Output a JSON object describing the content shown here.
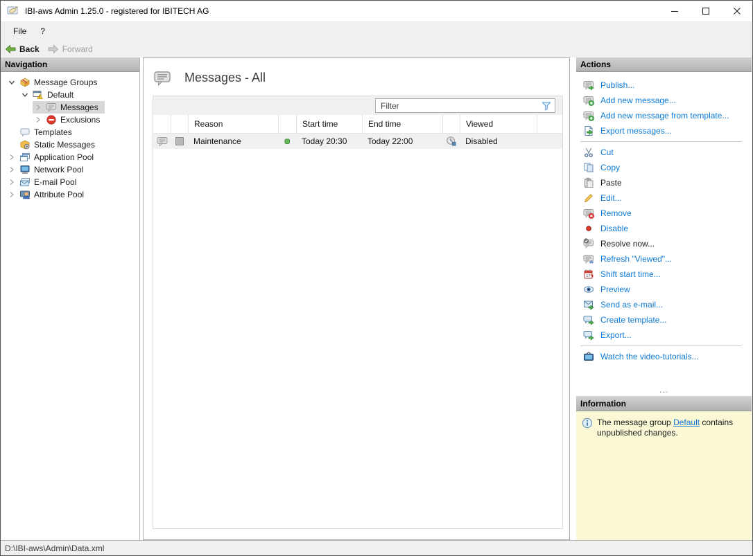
{
  "window": {
    "title": "IBI-aws Admin 1.25.0 - registered for IBITECH AG",
    "controls": [
      "minimize",
      "maximize",
      "close"
    ]
  },
  "menu": {
    "items": [
      "File",
      "?"
    ]
  },
  "toolbar": {
    "back": "Back",
    "forward": "Forward",
    "back_icon": "back-arrow",
    "forward_icon": "forward-arrow"
  },
  "navigation": {
    "header": "Navigation",
    "tree": [
      {
        "label": "Message Groups",
        "level": 0,
        "chevron": "down",
        "icon": "message-groups",
        "selected": false
      },
      {
        "label": "Default",
        "level": 1,
        "chevron": "down",
        "icon": "default-group",
        "selected": false
      },
      {
        "label": "Messages",
        "level": 2,
        "chevron": "right",
        "icon": "messages",
        "selected": true
      },
      {
        "label": "Exclusions",
        "level": 2,
        "chevron": "right",
        "icon": "exclusions",
        "selected": false
      },
      {
        "label": "Templates",
        "level": 0,
        "chevron": "none",
        "icon": "templates",
        "selected": false
      },
      {
        "label": "Static Messages",
        "level": 0,
        "chevron": "none",
        "icon": "static-messages",
        "selected": false
      },
      {
        "label": "Application Pool",
        "level": 0,
        "chevron": "right",
        "icon": "application-pool",
        "selected": false
      },
      {
        "label": "Network Pool",
        "level": 0,
        "chevron": "right",
        "icon": "network-pool",
        "selected": false
      },
      {
        "label": "E-mail Pool",
        "level": 0,
        "chevron": "right",
        "icon": "email-pool",
        "selected": false
      },
      {
        "label": "Attribute Pool",
        "level": 0,
        "chevron": "right",
        "icon": "attribute-pool",
        "selected": false
      }
    ]
  },
  "main": {
    "title": "Messages - All",
    "title_icon": "messages-bubble",
    "filter": {
      "placeholder": "Filter",
      "icon": "filter-funnel"
    },
    "table": {
      "columns": [
        "Reason",
        "Start time",
        "End time",
        "Viewed"
      ],
      "rows": [
        {
          "type_icon": "message-bubble",
          "color_icon": "gray-square",
          "reason": "Maintenance",
          "status_icon": "green-dot",
          "start_time": "Today 20:30",
          "end_time": "Today 22:00",
          "viewed_icon": "viewed-clock",
          "viewed": "Disabled"
        }
      ]
    }
  },
  "actions": {
    "header": "Actions",
    "splitter": "...",
    "items": [
      {
        "label": "Publish...",
        "icon": "publish",
        "enabled": true
      },
      {
        "label": "Add new message...",
        "icon": "add-message",
        "enabled": true
      },
      {
        "label": "Add new message from template...",
        "icon": "add-message",
        "enabled": true
      },
      {
        "label": "Export messages...",
        "icon": "export-messages",
        "enabled": true
      },
      {
        "type": "separator"
      },
      {
        "label": "Cut",
        "icon": "cut",
        "enabled": true
      },
      {
        "label": "Copy",
        "icon": "copy",
        "enabled": true
      },
      {
        "label": "Paste",
        "icon": "paste",
        "enabled": false
      },
      {
        "label": "Edit...",
        "icon": "edit",
        "enabled": true
      },
      {
        "label": "Remove",
        "icon": "remove",
        "enabled": true
      },
      {
        "label": "Disable",
        "icon": "disable",
        "enabled": true
      },
      {
        "label": "Resolve now...",
        "icon": "resolve",
        "enabled": false
      },
      {
        "label": "Refresh \"Viewed\"...",
        "icon": "refresh-viewed",
        "enabled": true
      },
      {
        "label": "Shift start time...",
        "icon": "shift-start-time",
        "enabled": true
      },
      {
        "label": "Preview",
        "icon": "preview",
        "enabled": true
      },
      {
        "label": "Send as e-mail...",
        "icon": "send-email",
        "enabled": true
      },
      {
        "label": "Create template...",
        "icon": "create-template",
        "enabled": true
      },
      {
        "label": "Export...",
        "icon": "export",
        "enabled": true
      },
      {
        "type": "separator"
      },
      {
        "label": "Watch the video-tutorials...",
        "icon": "video-tutorials",
        "enabled": true
      }
    ]
  },
  "information": {
    "header": "Information",
    "icon": "info",
    "message": {
      "before": "The message group ",
      "link": "Default",
      "after": " contains unpublished changes."
    }
  },
  "status_bar": {
    "path": "D:\\IBI-aws\\Admin\\Data.xml"
  },
  "colors": {
    "action_link": "#0e7ad6",
    "info_background": "#fbf8d5",
    "selection": "#d8d8d8",
    "panel_header_top": "#d2d2d2",
    "panel_header_bottom": "#b1b1b1",
    "status_green": "#6abf5e",
    "disable_red": "#e0382b"
  }
}
